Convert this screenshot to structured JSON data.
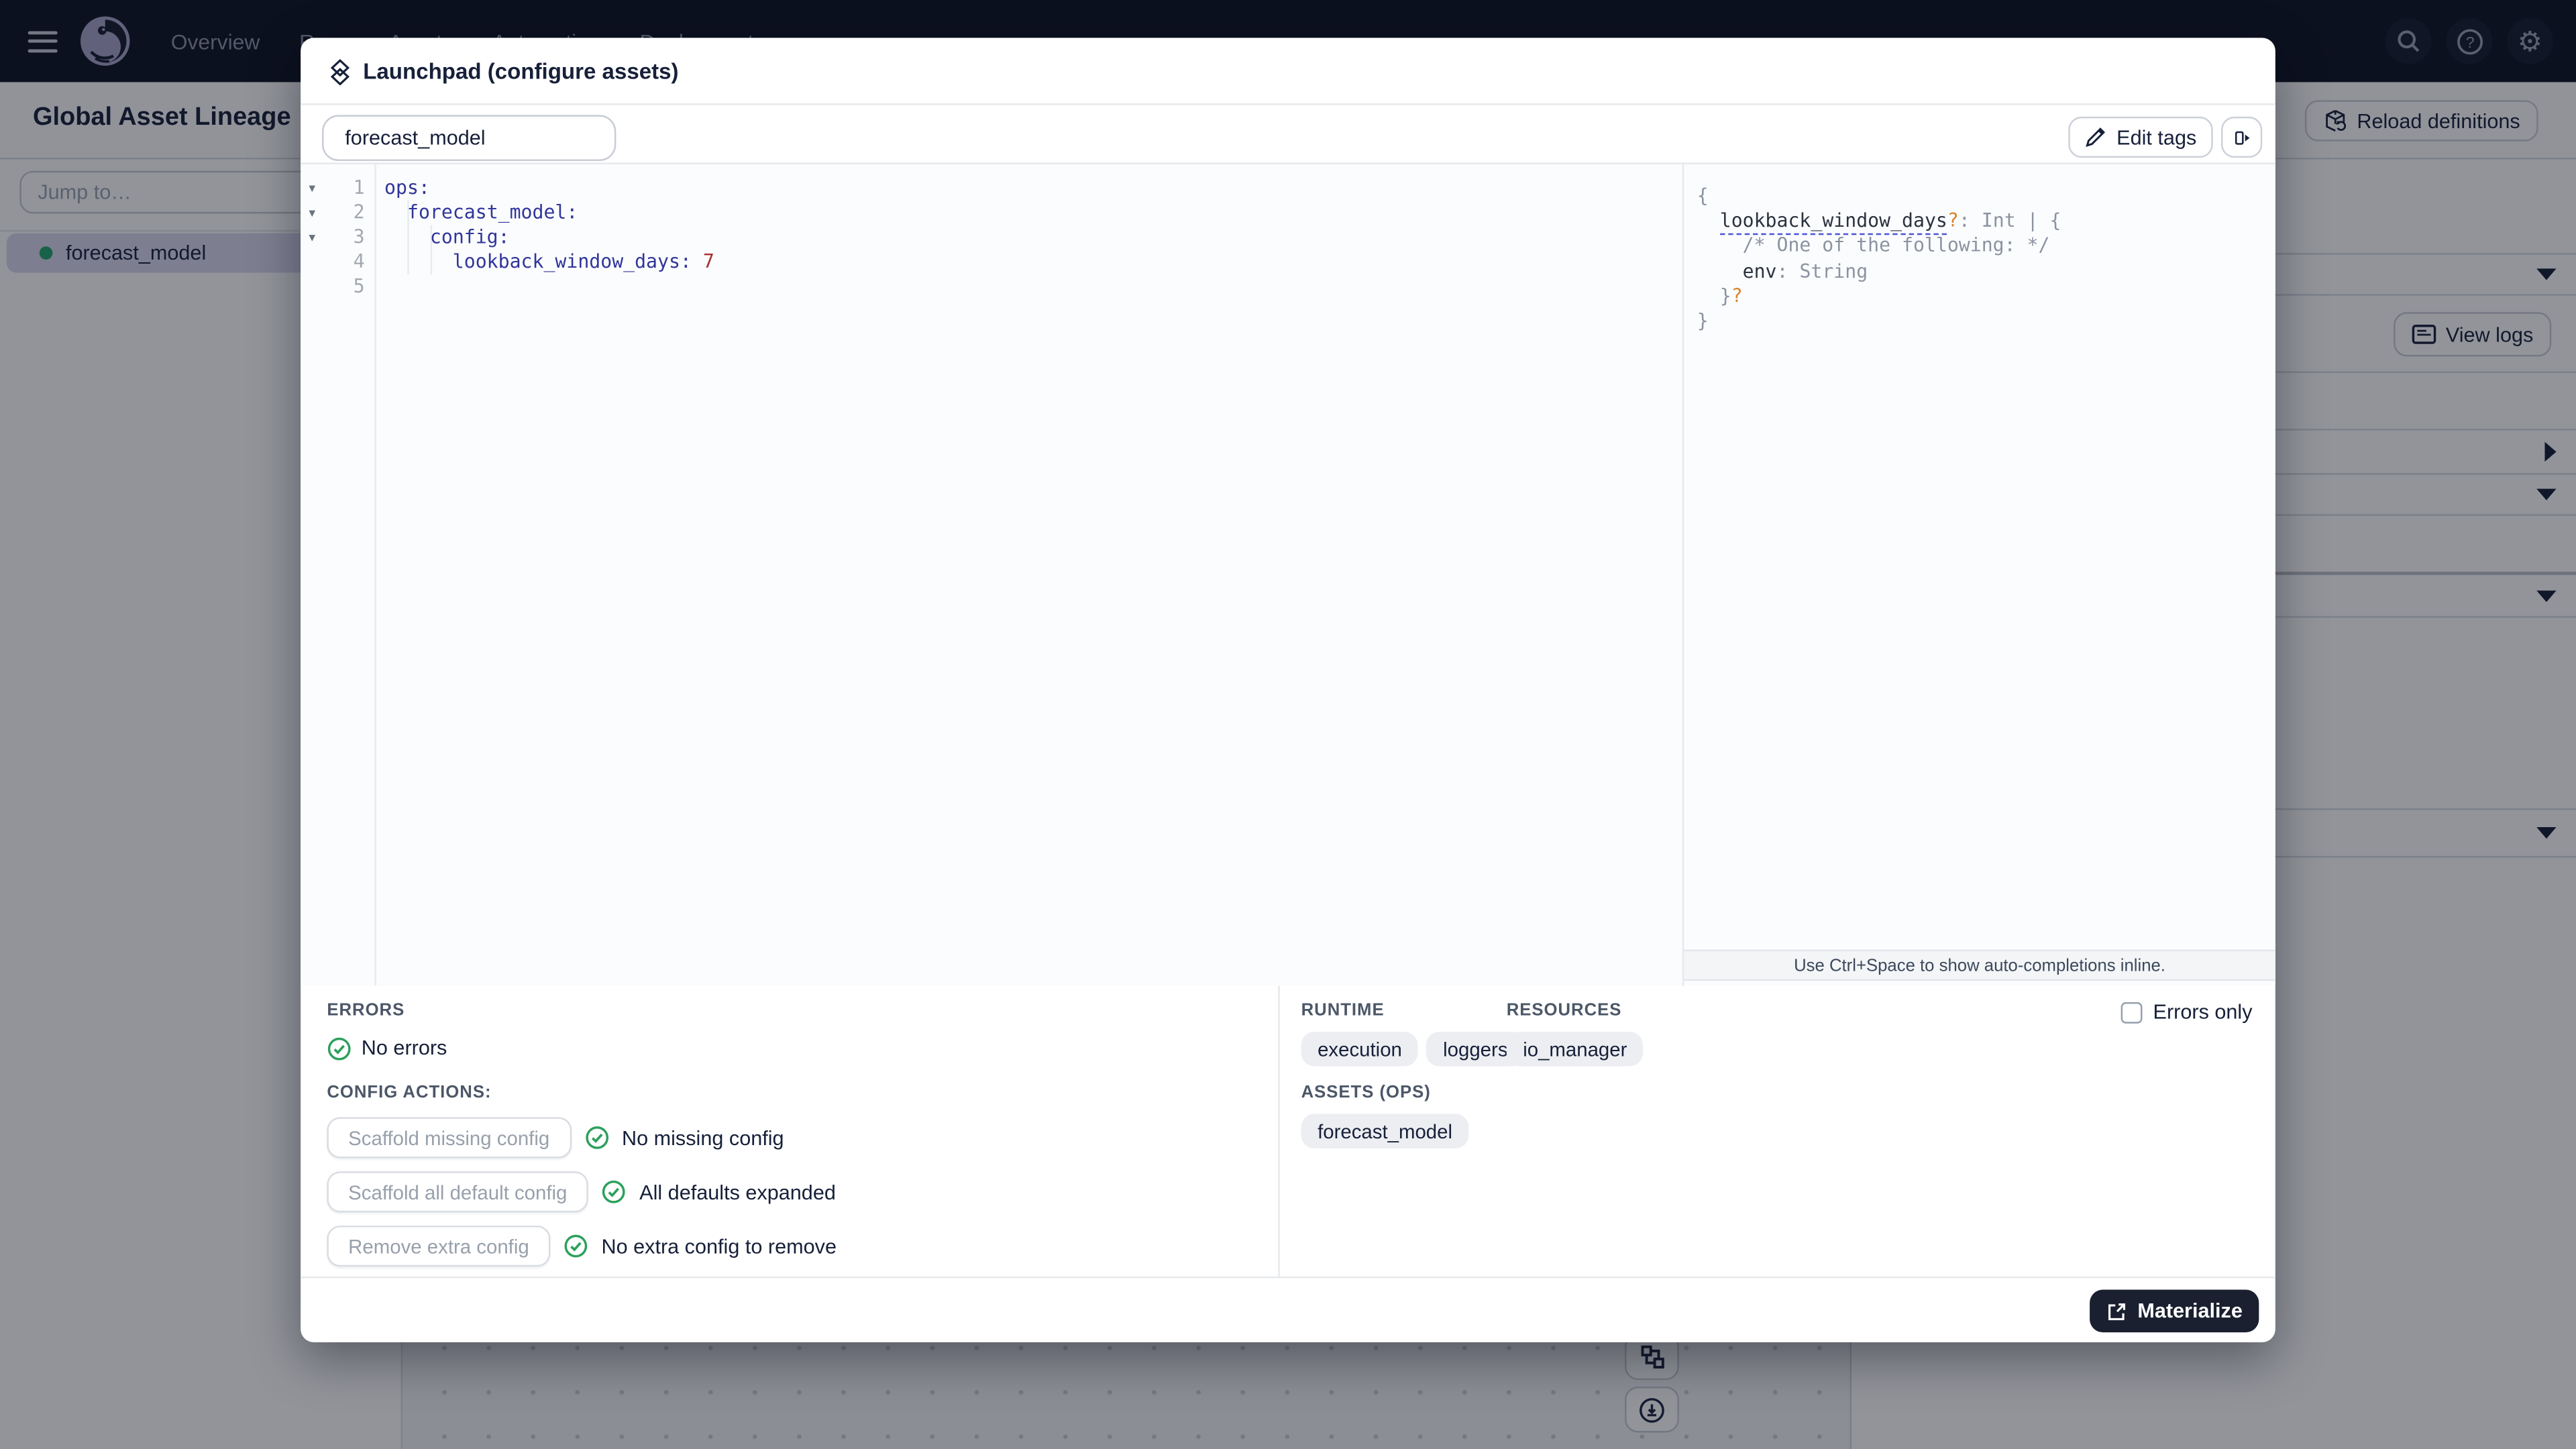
{
  "nav": {
    "items": [
      {
        "label": "Overview"
      },
      {
        "label": "Runs"
      },
      {
        "label": "Assets"
      },
      {
        "label": "Automation"
      },
      {
        "label": "Deployment"
      }
    ]
  },
  "header": {
    "title": "Global Asset Lineage",
    "reload_label": "Reload definitions"
  },
  "sidebar": {
    "jump_placeholder": "Jump to…",
    "asset": {
      "label": "forecast_model",
      "status_color": "#1fa46b"
    }
  },
  "details_panel": {
    "view_logs_label": "View logs"
  },
  "modal": {
    "title": "Launchpad (configure assets)",
    "tab_label": "forecast_model",
    "edit_tags_label": "Edit tags",
    "editor_lines": [
      {
        "num": "1",
        "fold": true,
        "tokens": [
          {
            "t": "ops:",
            "c": "k"
          }
        ]
      },
      {
        "num": "2",
        "fold": true,
        "tokens": [
          {
            "t": "  ",
            "c": ""
          },
          {
            "t": "forecast_model:",
            "c": "k"
          }
        ]
      },
      {
        "num": "3",
        "fold": true,
        "tokens": [
          {
            "t": "    ",
            "c": ""
          },
          {
            "t": "config:",
            "c": "k"
          }
        ]
      },
      {
        "num": "4",
        "fold": false,
        "tokens": [
          {
            "t": "      ",
            "c": ""
          },
          {
            "t": "lookback_window_days:",
            "c": "k"
          },
          {
            "t": " ",
            "c": ""
          },
          {
            "t": "7",
            "c": "num"
          }
        ]
      },
      {
        "num": "5",
        "fold": false,
        "tokens": []
      }
    ],
    "schema_lines": [
      [
        {
          "t": "{",
          "c": "p"
        }
      ],
      [
        {
          "t": "  ",
          "c": ""
        },
        {
          "t": "lookback_window_days",
          "c": "prop u"
        },
        {
          "t": "?",
          "c": "q"
        },
        {
          "t": ": Int | {",
          "c": "p"
        }
      ],
      [
        {
          "t": "    /* One of the following: */",
          "c": "cm"
        }
      ],
      [
        {
          "t": "    ",
          "c": ""
        },
        {
          "t": "env",
          "c": "prop"
        },
        {
          "t": ": String",
          "c": "p"
        }
      ],
      [
        {
          "t": "  }",
          "c": "p"
        },
        {
          "t": "?",
          "c": "q"
        }
      ],
      [
        {
          "t": "}",
          "c": "p"
        }
      ]
    ],
    "hint": "Use Ctrl+Space to show auto-completions inline.",
    "errors_label": "ERRORS",
    "errors_status": "No errors",
    "config_actions_label": "CONFIG ACTIONS:",
    "config_actions": [
      {
        "button": "Scaffold missing config",
        "status": "No missing config"
      },
      {
        "button": "Scaffold all default config",
        "status": "All defaults expanded"
      },
      {
        "button": "Remove extra config",
        "status": "No extra config to remove"
      }
    ],
    "tag_groups": [
      {
        "label": "RUNTIME",
        "tags": [
          "execution",
          "loggers"
        ]
      },
      {
        "label": "RESOURCES",
        "tags": [
          "io_manager"
        ]
      },
      {
        "label": "ASSETS (OPS)",
        "tags": [
          "forecast_model"
        ]
      }
    ],
    "errors_only_label": "Errors only",
    "materialize_label": "Materialize"
  },
  "colors": {
    "nav_bg": "#0c1120",
    "success_green": "#2ca05c",
    "yaml_key": "#30359b",
    "yaml_number": "#a52f2f",
    "schema_optional_orange": "#d9822b",
    "selection_lavender": "#dbd7ee",
    "materialize_bg": "#1a2030"
  }
}
